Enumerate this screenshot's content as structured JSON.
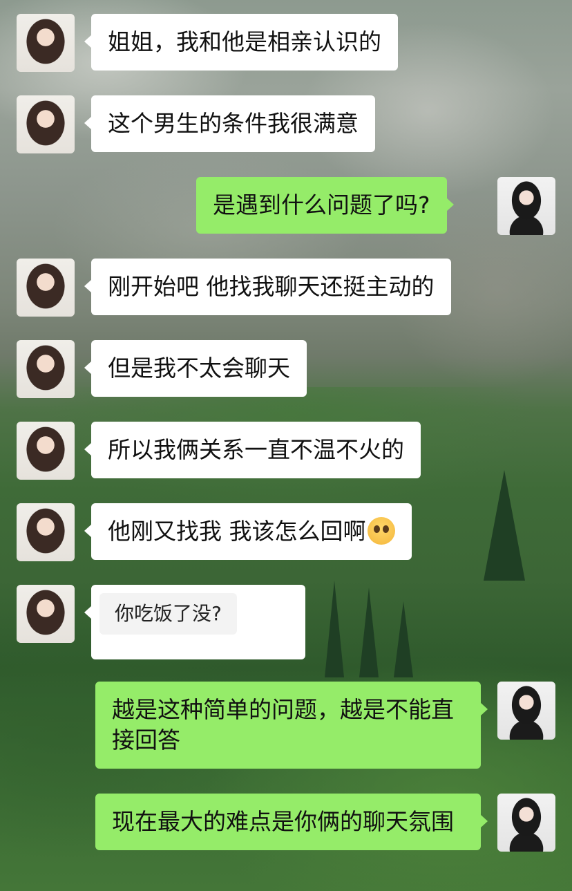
{
  "messages": [
    {
      "side": "left",
      "text": "姐姐，我和他是相亲认识的"
    },
    {
      "side": "left",
      "text": "这个男生的条件我很满意"
    },
    {
      "side": "right",
      "text": "是遇到什么问题了吗?"
    },
    {
      "side": "left",
      "text": "刚开始吧 他找我聊天还挺主动的"
    },
    {
      "side": "left",
      "text": "但是我不太会聊天"
    },
    {
      "side": "left",
      "text": "所以我俩关系一直不温不火的"
    },
    {
      "side": "left",
      "text": "他刚又找我 我该怎么回啊",
      "emoji": "pleading-face-emoji"
    },
    {
      "side": "left",
      "type": "quote",
      "text": "你吃饭了没?"
    },
    {
      "side": "right",
      "text": "越是这种简单的问题，越是不能直接回答"
    },
    {
      "side": "right",
      "text": "现在最大的难点是你俩的聊天氛围"
    }
  ],
  "colors": {
    "sent_bubble": "#95ec69",
    "received_bubble": "#ffffff"
  }
}
